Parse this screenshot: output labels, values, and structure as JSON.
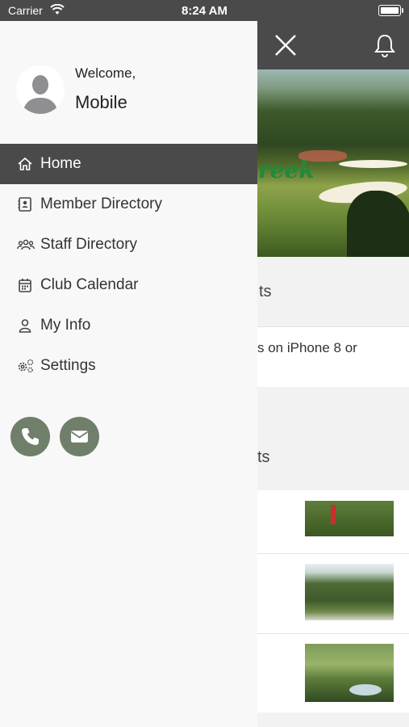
{
  "status_bar": {
    "carrier": "Carrier",
    "time": "8:24 AM"
  },
  "drawer": {
    "welcome": "Welcome,",
    "user_name": "Mobile",
    "nav": [
      {
        "label": "Home",
        "icon": "home-icon",
        "active": true
      },
      {
        "label": "Member Directory",
        "icon": "contact-card-icon",
        "active": false
      },
      {
        "label": "Staff Directory",
        "icon": "group-icon",
        "active": false
      },
      {
        "label": "Club Calendar",
        "icon": "calendar-icon",
        "active": false
      },
      {
        "label": "My Info",
        "icon": "person-icon",
        "active": false
      },
      {
        "label": "Settings",
        "icon": "gears-icon",
        "active": false
      }
    ],
    "contact_icons": [
      "phone-icon",
      "email-icon"
    ]
  },
  "background": {
    "hero_logo_text": "reek",
    "section1_text": "ts",
    "section2_text": "s on iPhone 8 or",
    "section3_text": "ts"
  },
  "colors": {
    "header": "#4a4a4a",
    "accent": "#6f7f6a",
    "drawer_bg": "#f8f8f8"
  }
}
